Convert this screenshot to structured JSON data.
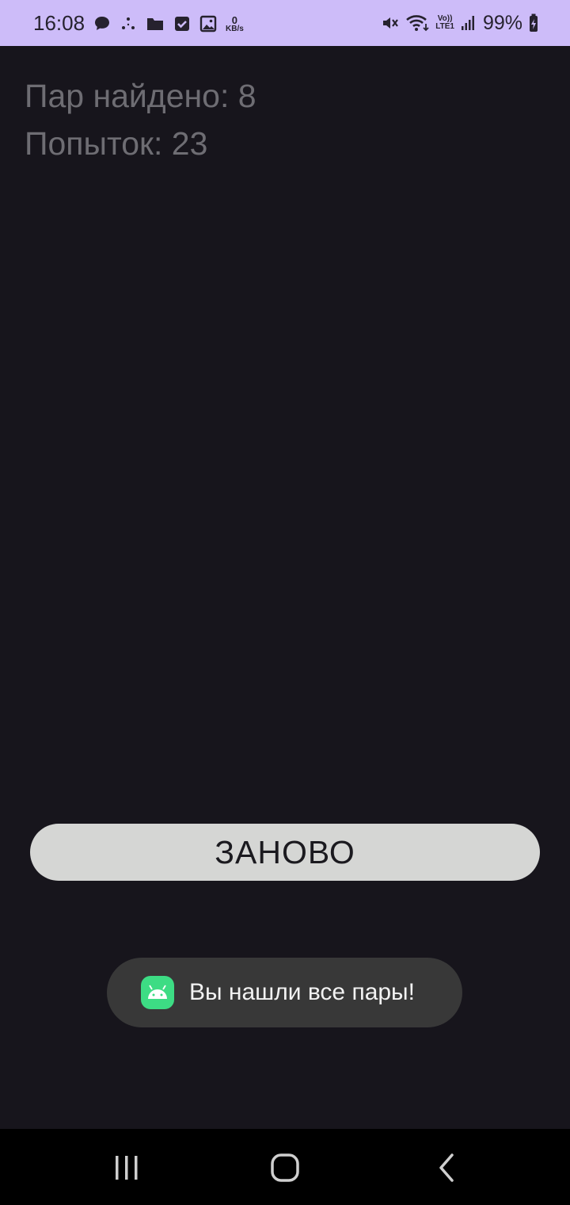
{
  "status_bar": {
    "time": "16:08",
    "speed_value": "0",
    "speed_unit": "KB/s",
    "lte_top": "Vo))",
    "lte_bottom": "LTE1",
    "battery": "99%",
    "background_color": "#cdbcf9",
    "left_icons": [
      "chat-bubble-icon",
      "dots-icon",
      "folder-icon",
      "checkbox-icon",
      "image-icon"
    ],
    "right_icons": [
      "vibrate-mute-icon",
      "wifi-icon",
      "lte-icon",
      "signal-icon",
      "battery-charging-icon"
    ]
  },
  "game": {
    "pairs_found": "Пар найдено: 8",
    "attempts": "Попыток: 23",
    "restart_label": "ЗАНОВО"
  },
  "toast": {
    "message": "Вы нашли все пары!",
    "icon": "android-app-icon"
  },
  "nav_bar": {
    "buttons": [
      "recents-icon",
      "home-icon",
      "back-icon"
    ]
  },
  "colors": {
    "background": "#17151c",
    "stat_text": "#6e6d73",
    "button": "#d5d6d4",
    "toast": "#383838",
    "android_green": "#3ddc84"
  }
}
